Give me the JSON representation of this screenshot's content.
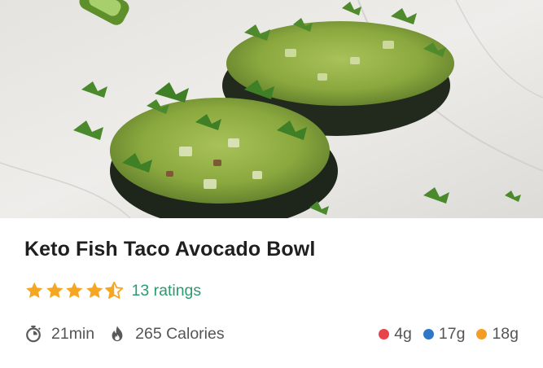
{
  "recipe": {
    "title": "Keto Fish Taco Avocado Bowl",
    "rating_value": 4.5,
    "ratings_label": "13 ratings",
    "time_label": "21min",
    "calories_label": "265 Calories",
    "macros": [
      {
        "label": "4g",
        "color": "#e8434a"
      },
      {
        "label": "17g",
        "color": "#2f77c7"
      },
      {
        "label": "18g",
        "color": "#f59d23"
      }
    ]
  },
  "colors": {
    "star": "#f5a623",
    "ratings_link": "#2c9a70",
    "title": "#1f1f1f",
    "meta_text": "#555555"
  },
  "icons": {
    "time": "stopwatch-icon",
    "calories": "flame-icon"
  }
}
